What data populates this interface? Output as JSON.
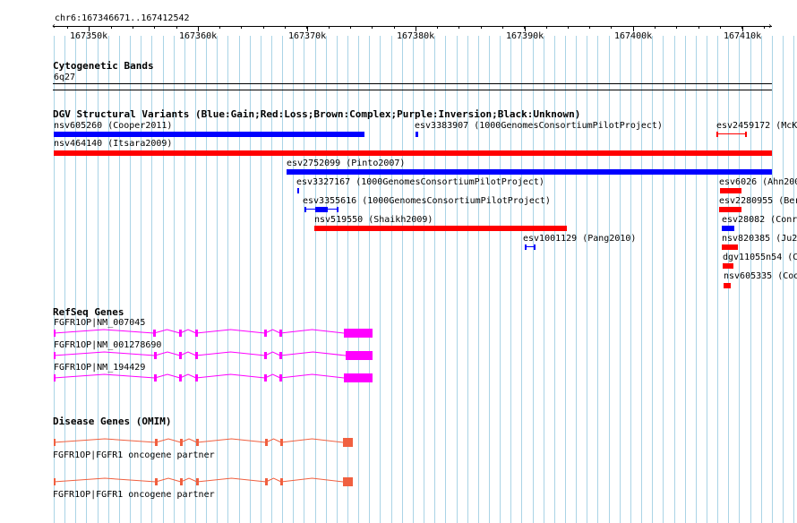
{
  "ruler": {
    "position_label": "chr6:167346671..167412542",
    "ticks": [
      "167350k",
      "167360k",
      "167370k",
      "167380k",
      "167390k",
      "167400k",
      "167410k"
    ]
  },
  "cytoband": {
    "title": "Cytogenetic Bands",
    "band": "6q27"
  },
  "dgv": {
    "title": "DGV Structural Variants (Blue:Gain;Red:Loss;Brown:Complex;Purple:Inversion;Black:Unknown)",
    "features": [
      {
        "id": "f1",
        "label": "nsv605260 (Cooper2011)",
        "color": "blue"
      },
      {
        "id": "f2",
        "label": "esv3383907 (1000GenomesConsortiumPilotProject)",
        "color": "blue"
      },
      {
        "id": "f3",
        "label": "esv2459172 (McK",
        "color": "red"
      },
      {
        "id": "f4",
        "label": "nsv464140 (Itsara2009)",
        "color": "red"
      },
      {
        "id": "f5",
        "label": "esv2752099 (Pinto2007)",
        "color": "blue"
      },
      {
        "id": "f6",
        "label": "esv3327167 (1000GenomesConsortiumPilotProject)",
        "color": "blue"
      },
      {
        "id": "f7",
        "label": "esv6026 (Ahn200",
        "color": "red"
      },
      {
        "id": "f8",
        "label": "esv3355616 (1000GenomesConsortiumPilotProject)",
        "color": "blue"
      },
      {
        "id": "f9",
        "label": "esv2280955 (Ber",
        "color": "red"
      },
      {
        "id": "f10",
        "label": "nsv519550 (Shaikh2009)",
        "color": "red"
      },
      {
        "id": "f11",
        "label": "esv28082 (Conr",
        "color": "blue"
      },
      {
        "id": "f12",
        "label": "esv1001129 (Pang2010)",
        "color": "blue"
      },
      {
        "id": "f13",
        "label": "nsv820385 (Ju2",
        "color": "red"
      },
      {
        "id": "f14",
        "label": "dgv11055n54 (C",
        "color": "red"
      },
      {
        "id": "f15",
        "label": "nsv605335 (Coo",
        "color": "red"
      }
    ]
  },
  "refseq": {
    "title": "RefSeq Genes",
    "transcripts": [
      "FGFR1OP|NM_007045",
      "FGFR1OP|NM_001278690",
      "FGFR1OP|NM_194429"
    ],
    "color": "#ff00ff"
  },
  "omim": {
    "title": "Disease Genes (OMIM)",
    "genes": [
      "FGFR1OP|FGFR1 oncogene partner",
      "FGFR1OP|FGFR1 oncogene partner"
    ],
    "color": "#f06040"
  },
  "colors": {
    "gain": "#0000ff",
    "loss": "#ff0000",
    "grid": "#aad4e6"
  }
}
